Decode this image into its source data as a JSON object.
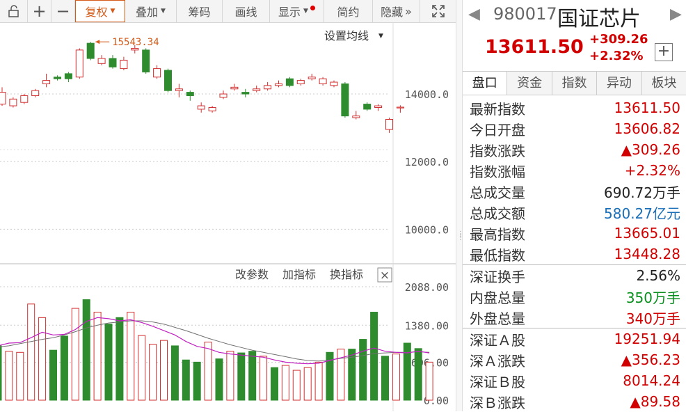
{
  "toolbar": {
    "buttons": [
      {
        "label": "",
        "icon": "unlock-icon",
        "name": "unlock-button",
        "w": 40
      },
      {
        "label": "",
        "icon": "plus-icon",
        "name": "zoom-in-button",
        "w": 34,
        "glyph": "+"
      },
      {
        "label": "",
        "icon": "minus-icon",
        "name": "zoom-out-button",
        "w": 34,
        "glyph": "−"
      }
    ],
    "fuquan": "复权",
    "diejia": "叠加",
    "chouma": "筹码",
    "huaxian": "画线",
    "xianshi": "显示",
    "jianyue": "简约",
    "yincang": "隐藏",
    "expand_glyph": "»"
  },
  "chart": {
    "ma_setting": "设置均线",
    "high_label": "15543.34",
    "price_ticks": [
      "14000.0",
      "12000.0",
      "10000.0"
    ],
    "vol_ticks": [
      "2088.00",
      "1380.00",
      "696.00",
      "0.00"
    ],
    "vol_toolbar": {
      "change": "改参数",
      "add": "加指标",
      "switch": "换指标",
      "close": "×"
    },
    "colors": {
      "up": "#d22e2e",
      "down": "#2e8b2e",
      "ma_magenta": "#c020c0",
      "ma_gray": "#707070",
      "high_label": "#d45a18"
    }
  },
  "chart_data": {
    "type": "candlestick",
    "candles": [
      {
        "o": 13700,
        "c": 14050,
        "h": 14200,
        "l": 13650
      },
      {
        "o": 13650,
        "c": 13850,
        "h": 13900,
        "l": 13600
      },
      {
        "o": 13750,
        "c": 13950,
        "h": 14000,
        "l": 13700
      },
      {
        "o": 13950,
        "c": 14100,
        "h": 14150,
        "l": 13900
      },
      {
        "o": 14300,
        "c": 14400,
        "h": 14600,
        "l": 14200
      },
      {
        "o": 14500,
        "c": 14450,
        "h": 14550,
        "l": 14400
      },
      {
        "o": 14600,
        "c": 14450,
        "h": 14650,
        "l": 14350
      },
      {
        "o": 14500,
        "c": 15300,
        "h": 15350,
        "l": 14450
      },
      {
        "o": 15500,
        "c": 15050,
        "h": 15543,
        "l": 15000
      },
      {
        "o": 14900,
        "c": 15050,
        "h": 15150,
        "l": 14850
      },
      {
        "o": 15050,
        "c": 14800,
        "h": 15150,
        "l": 14750
      },
      {
        "o": 14750,
        "c": 15000,
        "h": 15100,
        "l": 14700
      },
      {
        "o": 15300,
        "c": 15350,
        "h": 15450,
        "l": 15200
      },
      {
        "o": 15300,
        "c": 14650,
        "h": 15350,
        "l": 14600
      },
      {
        "o": 14500,
        "c": 14750,
        "h": 14850,
        "l": 14450
      },
      {
        "o": 14700,
        "c": 14100,
        "h": 14750,
        "l": 14050
      },
      {
        "o": 14100,
        "c": 14150,
        "h": 14300,
        "l": 13900
      },
      {
        "o": 14050,
        "c": 13950,
        "h": 14100,
        "l": 13800
      },
      {
        "o": 13550,
        "c": 13650,
        "h": 13750,
        "l": 13450
      },
      {
        "o": 13500,
        "c": 13600,
        "h": 13650,
        "l": 13450
      },
      {
        "o": 13900,
        "c": 14000,
        "h": 14100,
        "l": 13850
      },
      {
        "o": 14150,
        "c": 14200,
        "h": 14300,
        "l": 14100
      },
      {
        "o": 14050,
        "c": 14000,
        "h": 14150,
        "l": 13900
      },
      {
        "o": 14100,
        "c": 14150,
        "h": 14250,
        "l": 14050
      },
      {
        "o": 14150,
        "c": 14250,
        "h": 14350,
        "l": 14100
      },
      {
        "o": 14250,
        "c": 14300,
        "h": 14400,
        "l": 14200
      },
      {
        "o": 14450,
        "c": 14250,
        "h": 14500,
        "l": 14200
      },
      {
        "o": 14300,
        "c": 14400,
        "h": 14450,
        "l": 14250
      },
      {
        "o": 14450,
        "c": 14500,
        "h": 14600,
        "l": 14400
      },
      {
        "o": 14300,
        "c": 14450,
        "h": 14500,
        "l": 14250
      },
      {
        "o": 14250,
        "c": 14350,
        "h": 14400,
        "l": 14200
      },
      {
        "o": 14300,
        "c": 13350,
        "h": 14350,
        "l": 13300
      },
      {
        "o": 13300,
        "c": 13350,
        "h": 13500,
        "l": 13250
      },
      {
        "o": 13700,
        "c": 13550,
        "h": 13750,
        "l": 13500
      },
      {
        "o": 13600,
        "c": 13650,
        "h": 13700,
        "l": 13500
      },
      {
        "o": 12950,
        "c": 13250,
        "h": 13300,
        "l": 12850
      },
      {
        "o": 13606,
        "c": 13611,
        "h": 13665,
        "l": 13448
      }
    ],
    "volume": [
      1000,
      900,
      880,
      1770,
      1520,
      920,
      1180,
      1690,
      1850,
      1620,
      1400,
      1520,
      1620,
      1190,
      1030,
      1100,
      1000,
      740,
      700,
      1070,
      760,
      900,
      870,
      900,
      810,
      600,
      640,
      550,
      600,
      700,
      880,
      940,
      940,
      1120,
      1620,
      810,
      850,
      1050,
      950,
      700
    ],
    "vol_up": [
      false,
      true,
      true,
      true,
      true,
      false,
      false,
      true,
      false,
      true,
      false,
      false,
      true,
      true,
      true,
      true,
      false,
      false,
      false,
      true,
      false,
      true,
      false,
      false,
      true,
      false,
      true,
      true,
      true,
      true,
      false,
      true,
      false,
      false,
      false,
      false,
      true,
      false,
      false,
      true
    ],
    "ma_magenta": [
      1000,
      1050,
      1060,
      1150,
      1250,
      1200,
      1210,
      1300,
      1450,
      1520,
      1500,
      1460,
      1480,
      1430,
      1360,
      1280,
      1200,
      1080,
      990,
      950,
      880,
      850,
      830,
      810,
      790,
      740,
      700,
      680,
      670,
      680,
      730,
      780,
      830,
      900,
      960,
      900,
      880,
      870,
      900,
      870
    ],
    "ma_gray": [
      980,
      1000,
      1040,
      1080,
      1120,
      1150,
      1200,
      1260,
      1330,
      1380,
      1420,
      1440,
      1460,
      1460,
      1440,
      1400,
      1340,
      1280,
      1210,
      1140,
      1080,
      1020,
      970,
      920,
      880,
      840,
      800,
      760,
      730,
      720,
      740,
      770,
      790,
      820,
      860,
      870,
      880,
      880,
      890,
      880
    ],
    "price_ylim": [
      9000,
      16100
    ],
    "vol_ylim": [
      0,
      2088
    ]
  },
  "panel": {
    "code": "980017",
    "name": "国证芯片",
    "price": "13611.50",
    "change": "+309.26",
    "pct": "+2.32%",
    "add": "+",
    "left_arrow": "◀",
    "right_arrow": "▶",
    "tabs": [
      "盘口",
      "资金",
      "指数",
      "异动",
      "板块"
    ],
    "rows1": [
      {
        "label": "最新指数",
        "value": "13611.50",
        "cls": ""
      },
      {
        "label": "今日开盘",
        "value": "13606.82",
        "cls": ""
      },
      {
        "label": "指数涨跌",
        "value": "▲309.26",
        "cls": ""
      },
      {
        "label": "指数涨幅",
        "value": "+2.32%",
        "cls": ""
      },
      {
        "label": "总成交量",
        "value": "690.72万手",
        "cls": "black"
      },
      {
        "label": "总成交额",
        "value": "580.27亿元",
        "cls": "blue"
      },
      {
        "label": "最高指数",
        "value": "13665.01",
        "cls": ""
      },
      {
        "label": "最低指数",
        "value": "13448.28",
        "cls": ""
      }
    ],
    "rows2": [
      {
        "label": "深证换手",
        "value": "2.56%",
        "cls": "black"
      },
      {
        "label": "内盘总量",
        "value": "350万手",
        "cls": "green"
      },
      {
        "label": "外盘总量",
        "value": "340万手",
        "cls": ""
      }
    ],
    "rows3": [
      {
        "label": "深证Ａ股",
        "value": "19251.94",
        "cls": ""
      },
      {
        "label": "深Ａ涨跌",
        "value": "▲356.23",
        "cls": ""
      },
      {
        "label": "深证Ｂ股",
        "value": "8014.24",
        "cls": ""
      },
      {
        "label": "深Ｂ涨跌",
        "value": "▲89.58",
        "cls": ""
      }
    ]
  }
}
